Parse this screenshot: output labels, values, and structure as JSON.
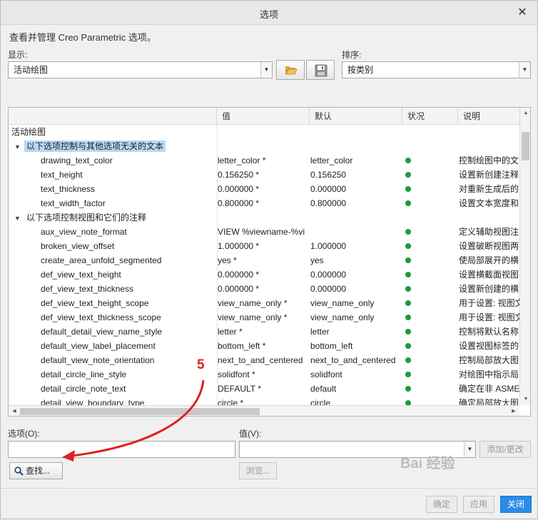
{
  "window": {
    "title": "选项",
    "close_label": "✕"
  },
  "description": "查看并管理 Creo Parametric 选项。",
  "display": {
    "label": "显示:",
    "value": "活动绘图"
  },
  "sort": {
    "label": "排序:",
    "value": "按类别"
  },
  "table": {
    "columns": [
      "",
      "值",
      "默认",
      "状况",
      "说明"
    ],
    "root": "活动绘图",
    "rows": [
      {
        "kind": "group",
        "label": "以下选项控制与其他选项无关的文本",
        "highlight": true
      },
      {
        "kind": "opt",
        "name": "drawing_text_color",
        "value": "letter_color *",
        "default": "letter_color",
        "desc": "控制绘图中的文"
      },
      {
        "kind": "opt",
        "name": "text_height",
        "value": "0.156250 *",
        "default": "0.156250",
        "desc": "设置新创建注释"
      },
      {
        "kind": "opt",
        "name": "text_thickness",
        "value": "0.000000 *",
        "default": "0.000000",
        "desc": "对重新生成后的"
      },
      {
        "kind": "opt",
        "name": "text_width_factor",
        "value": "0.800000 *",
        "default": "0.800000",
        "desc": "设置文本宽度和"
      },
      {
        "kind": "group",
        "label": "以下选项控制视图和它们的注释",
        "highlight": false
      },
      {
        "kind": "opt",
        "name": "aux_view_note_format",
        "value": "VIEW %viewname-%vi",
        "default": "",
        "desc": "定义辅助视图注"
      },
      {
        "kind": "opt",
        "name": "broken_view_offset",
        "value": "1.000000 *",
        "default": "1.000000",
        "desc": "设置破断视图两"
      },
      {
        "kind": "opt",
        "name": "create_area_unfold_segmented",
        "value": "yes *",
        "default": "yes",
        "desc": "使局部展开的横"
      },
      {
        "kind": "opt",
        "name": "def_view_text_height",
        "value": "0.000000 *",
        "default": "0.000000",
        "desc": "设置横截面视图"
      },
      {
        "kind": "opt",
        "name": "def_view_text_thickness",
        "value": "0.000000 *",
        "default": "0.000000",
        "desc": "设置新创建的横"
      },
      {
        "kind": "opt",
        "name": "def_view_text_height_scope",
        "value": "view_name_only *",
        "default": "view_name_only",
        "desc": "用于设置: 视图文"
      },
      {
        "kind": "opt",
        "name": "def_view_text_thickness_scope",
        "value": "view_name_only *",
        "default": "view_name_only",
        "desc": "用于设置: 视图文"
      },
      {
        "kind": "opt",
        "name": "default_detail_view_name_style",
        "value": "letter *",
        "default": "letter",
        "desc": "控制将默认名称"
      },
      {
        "kind": "opt",
        "name": "default_view_label_placement",
        "value": "bottom_left *",
        "default": "bottom_left",
        "desc": "设置视图标签的"
      },
      {
        "kind": "opt",
        "name": "default_view_note_orientation",
        "value": "next_to_and_centered",
        "default": "next_to_and_centered",
        "desc": "控制局部放大图"
      },
      {
        "kind": "opt",
        "name": "detail_circle_line_style",
        "value": "solidfont *",
        "default": "solidfont",
        "desc": "对绘图中指示局"
      },
      {
        "kind": "opt",
        "name": "detail_circle_note_text",
        "value": "DEFAULT *",
        "default": "default",
        "desc": "确定在非 ASME"
      },
      {
        "kind": "opt",
        "name": "detail_view_boundary_type",
        "value": "circle *",
        "default": "circle",
        "desc": "确定局部放大图"
      }
    ]
  },
  "option": {
    "label": "选项(O):",
    "value": ""
  },
  "value_field": {
    "label": "值(V):",
    "value": ""
  },
  "buttons": {
    "add_change": "添加/更改",
    "find": "查找...",
    "browse": "浏览...",
    "ok": "确定",
    "apply": "应用",
    "close": "关闭"
  },
  "annotation": {
    "step_number": "5",
    "arrow_color": "#e02020"
  },
  "watermark": "Bai 经验",
  "colors": {
    "status_ok": "#1f9a3a",
    "highlight": "#b8d9f7",
    "primary": "#2a8ce8"
  }
}
